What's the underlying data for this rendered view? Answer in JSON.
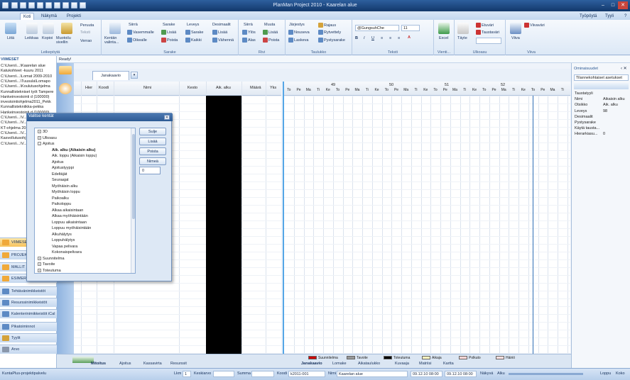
{
  "title": "PlanMan Project 2010 - Kaarelan alue",
  "menu": {
    "tabs": [
      "Koti",
      "Näkymä",
      "Projekti"
    ],
    "right": [
      "Työpöytä",
      "Tyyli"
    ]
  },
  "ribbon": {
    "groups": {
      "g1": "Leikepöytä",
      "g2": "Sarake",
      "g3": "Rivi",
      "g4": "Taulukko",
      "g5": "Teksti",
      "g6": "Vienti...",
      "g7": "Ulkoasu",
      "g8": "Viiva"
    },
    "clip": {
      "paste": "Liitä",
      "cut": "Leikkaa",
      "copy": "Kopioi",
      "painter": "Muotoilu sivellin",
      "undo": "Peruuta",
      "redo": "Teksti",
      "restore": "Verrao"
    },
    "col": {
      "add": "Kentän valinta...",
      "move": "Siirrä",
      "left": "Vasemmalle",
      "right": "Oikealle",
      "colh": "Sarake",
      "insert": "Lisää",
      "del": "Poista",
      "width": "Leveys",
      "wcol": "Sarake",
      "wall": "Kaikki",
      "dec": "Desimaalit",
      "decadd": "Lisää",
      "decsub": "Vähennä"
    },
    "row": {
      "move": "Siirrä",
      "up": "Ylös",
      "down": "Alas",
      "edit": "Muuta",
      "insert": "Lisää",
      "del": "Poista"
    },
    "table": {
      "order": "Järjestys",
      "asc": "Nouseva",
      "desc": "Laskeva",
      "limit": "Rajaus",
      "filter": "Rytvettely",
      "tooltip": "Pystysarake"
    },
    "text": {
      "font": "@GungsuhChe",
      "size": "11"
    },
    "export": {
      "excel": "Excel"
    },
    "look": {
      "fill": "Täyte",
      "fg": "Etuväri",
      "bg": "Taustaväri"
    },
    "line": {
      "line": "Viiva",
      "color": "Viivaväri"
    }
  },
  "ready": "Ready!",
  "left": {
    "header": "VIIMESET",
    "recent": [
      "C:\\Users\\...\\Kaarelan alue",
      "Katukohteet -kuuru 2011",
      "C:\\Users\\...\\Lomat 2009-2010",
      "C:\\Users\\...\\Tuusula\\Lomapo",
      "C:\\Users\\...\\Koulutusohjelma",
      "Kunnallistekniset työt Tampere",
      "Hankeinvestointi d (100000)",
      "investointiohjelma2011_Pekk",
      "Kunnallistekniikka-pekka",
      "Hankeinvestointi d (100000)",
      "C:\\Users\\...\\V...",
      "C:\\Users\\...\\V...",
      "KT-ohjelma 2011",
      "C:\\Users\\...\\V...",
      "Kasvollutusohj...",
      "C:\\Users\\...\\V..."
    ],
    "nav": [
      "VIIMESET",
      "PROJEKTIT",
      "MALLIT",
      "ESIMERKIT",
      "Tehtävänimikkeistöt",
      "Resurssinimikkeistöt",
      "Kalenterinimikkeistöt iCal",
      "Pikatoiminnot",
      "Tyylit",
      "Arvo"
    ]
  },
  "viewtab": "Janakaavio",
  "grid": {
    "cols": [
      "Hier",
      "Koodi",
      "Nimi",
      "Kesto",
      "Aik. alku",
      "Määrä",
      "Yks"
    ]
  },
  "chart": {
    "weeks": [
      "49",
      "50",
      "51",
      "52"
    ],
    "days": [
      "To",
      "Pe",
      "Ma",
      "Ti",
      "Ke",
      "To",
      "Pe",
      "Ma",
      "Ti",
      "Ke",
      "To",
      "Pe",
      "Ma",
      "Ti",
      "Ke",
      "To",
      "Pe",
      "Ma",
      "Ti",
      "Ke",
      "To",
      "Pe",
      "Ma",
      "Ti",
      "Ke",
      "To",
      "Pe",
      "Ma",
      "Ti"
    ]
  },
  "props": {
    "title": "Ominaisuudet",
    "select": "Tilannekohtaiset asetukset",
    "rows": [
      [
        "Taustatyyli",
        ""
      ],
      [
        "Nimi",
        "Aikaisin alku"
      ],
      [
        "Otsikko",
        "Aik. alku"
      ],
      [
        "Leveys",
        "98"
      ],
      [
        "Desimaalit",
        ""
      ],
      [
        "Pystysarake",
        ""
      ],
      [
        "Käytä tausta...",
        ""
      ],
      [
        "Hierarkiasu...",
        "0"
      ]
    ]
  },
  "bottom": {
    "tabs": [
      "Mitoitus",
      "Ajoitus",
      "Kassavirta",
      "Resurssit"
    ],
    "tabs2": [
      "Janakaavio",
      "Lomake",
      "Aikataulukko",
      "Kuvaaja",
      "Matriisi",
      "Kartta"
    ],
    "legend": [
      "Suunnitelma",
      "Tavoite",
      "Toteutuma",
      "Aikaja",
      "Polkuto",
      "Häiriö"
    ]
  },
  "status": {
    "app": "KuntaPlus-projektipalvelu",
    "lkm": "Lkm",
    "lkm_v": "1",
    "keskiarvo": "Keskiarvo",
    "summa": "Summa",
    "koodi": "Koodi",
    "koodi_v": "k2011-001",
    "nimi": "Nimi",
    "nimi_v": "Kaarelan alue",
    "d1": "09.12.10 08:00",
    "d2": "09.12.10 08:00",
    "view": "Näkyvä",
    "alku": "Alku",
    "loppu": "Loppu",
    "koko": "Koko"
  },
  "dialog": {
    "title": "Valitse kentät",
    "buttons": [
      "Sulje",
      "Lisää",
      "Poista",
      "Nimeä"
    ],
    "spin": "0",
    "tree": [
      {
        "t": "3D",
        "lvl": 0,
        "exp": "+"
      },
      {
        "t": "Ulkoasu",
        "lvl": 0,
        "exp": "+"
      },
      {
        "t": "Ajoitus",
        "lvl": 0,
        "exp": "-"
      },
      {
        "t": "Aik. alku (Aikaisin alku)",
        "lvl": 1,
        "bold": true
      },
      {
        "t": "Aik. loppu (Aikaisin loppu)",
        "lvl": 1
      },
      {
        "t": "Ajoitus",
        "lvl": 1
      },
      {
        "t": "Ajoitustyyppi",
        "lvl": 1
      },
      {
        "t": "Edeltäjät",
        "lvl": 1
      },
      {
        "t": "Seuraajat",
        "lvl": 1
      },
      {
        "t": "Myöhäisin alku",
        "lvl": 1
      },
      {
        "t": "Myöhäisin loppu",
        "lvl": 1
      },
      {
        "t": "Paikoalku",
        "lvl": 1
      },
      {
        "t": "Paikoloppu",
        "lvl": 1
      },
      {
        "t": "Alkaa aikaisintaan",
        "lvl": 1
      },
      {
        "t": "Alkaa myöhäisintään",
        "lvl": 1
      },
      {
        "t": "Loppuu aikaisintaan",
        "lvl": 1
      },
      {
        "t": "Loppuu myöhäisintään",
        "lvl": 1
      },
      {
        "t": "Alkuhälytys",
        "lvl": 1
      },
      {
        "t": "Loppuhälytys",
        "lvl": 1
      },
      {
        "t": "Vapaa pelivara",
        "lvl": 1
      },
      {
        "t": "Kokonaispelivara",
        "lvl": 1
      },
      {
        "t": "Suunnitelma",
        "lvl": 0,
        "exp": "+"
      },
      {
        "t": "Tavoite",
        "lvl": 0,
        "exp": "+"
      },
      {
        "t": "Toteutuma",
        "lvl": 0,
        "exp": "+"
      }
    ]
  },
  "colors": {
    "accent": "#2d5a94",
    "black": "#000000",
    "plan": "#cc0000",
    "target": "#9a9a9a",
    "actual": "#000000"
  }
}
